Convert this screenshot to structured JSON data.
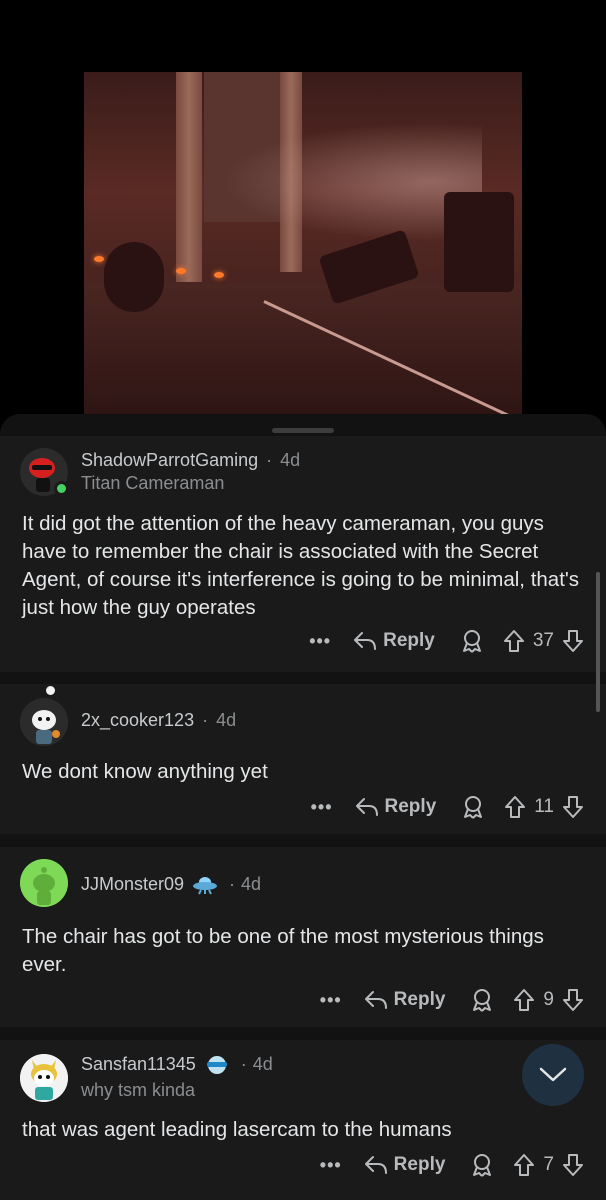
{
  "comments": [
    {
      "username": "ShadowParrotGaming",
      "separator": "·",
      "time": "4d",
      "flair": "Titan Cameraman",
      "body": "It did got the attention of the heavy cameraman, you guys have to remember the chair is associated with the Secret Agent, of course it's interference is going to be minimal, that's just how the guy operates",
      "more": "•••",
      "reply_label": "Reply",
      "votes": "37"
    },
    {
      "username": "2x_cooker123",
      "separator": "·",
      "time": "4d",
      "flair": "",
      "body": "We dont know anything yet",
      "more": "•••",
      "reply_label": "Reply",
      "votes": "11"
    },
    {
      "username": "JJMonster09",
      "separator": "·",
      "time": "4d",
      "flair": "",
      "body": "The chair has got to be one of the most mysterious things ever.",
      "more": "•••",
      "reply_label": "Reply",
      "votes": "9"
    },
    {
      "username": "Sansfan11345",
      "separator": "·",
      "time": "4d",
      "flair": "why tsm kinda",
      "body": "that was agent leading lasercam to the humans",
      "more": "•••",
      "reply_label": "Reply",
      "votes": "7"
    }
  ],
  "colors": {
    "sheet_bg": "#121212",
    "card_bg": "#1a1a1b",
    "online": "#46d160",
    "avatar_green": "#7ed957"
  },
  "icons": [
    "reply-arrow-icon",
    "award-icon",
    "upvote-icon",
    "downvote-icon",
    "chevron-down-icon"
  ]
}
